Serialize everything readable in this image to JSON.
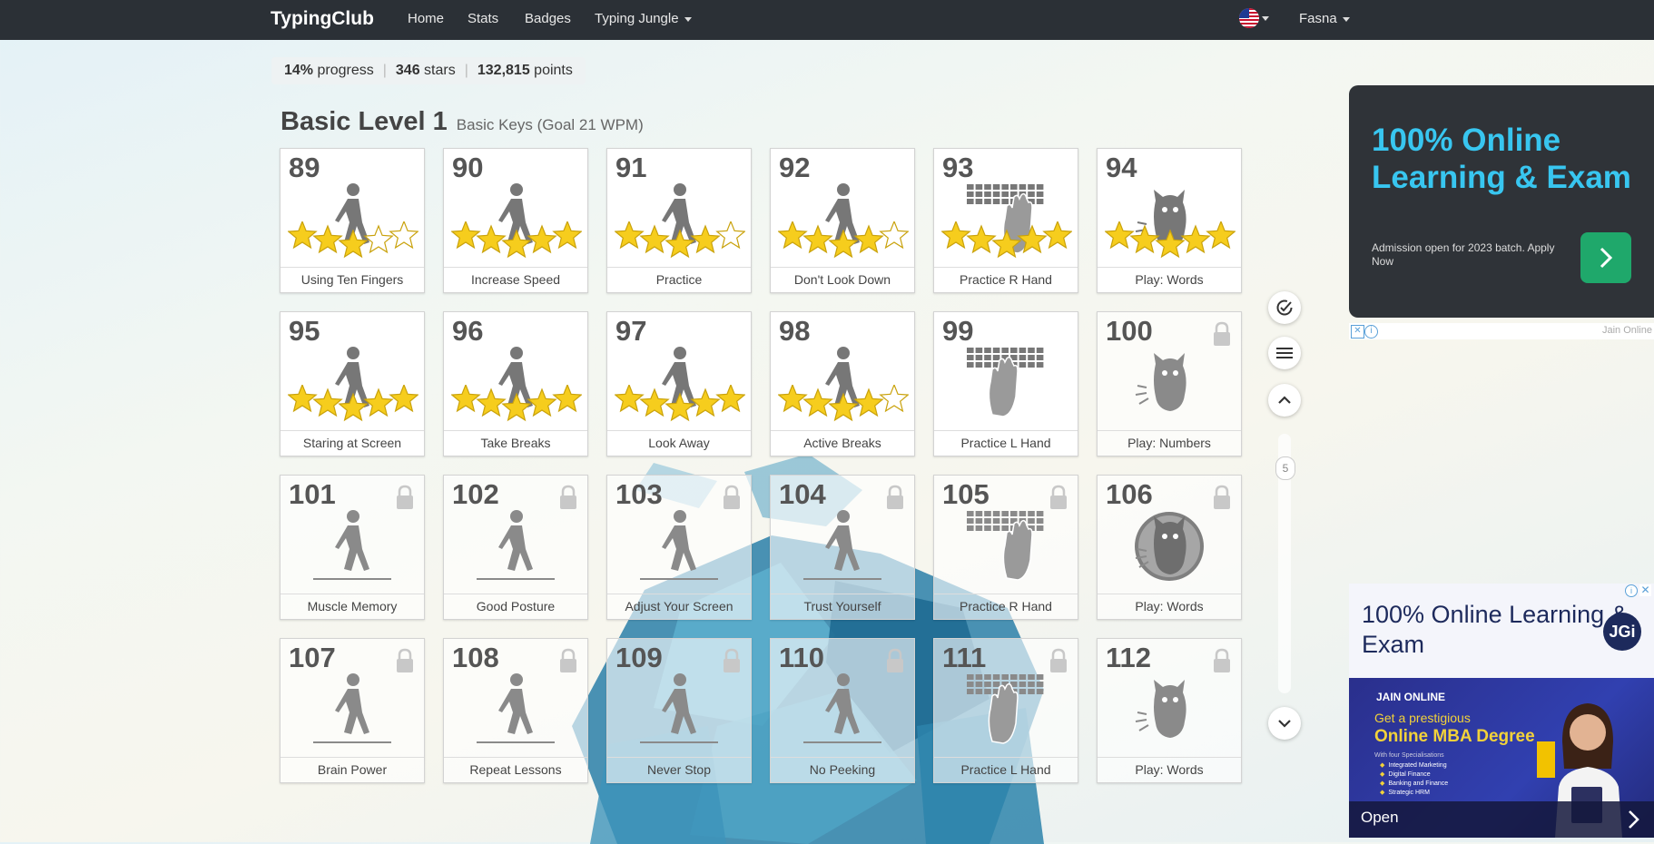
{
  "nav": {
    "brand": "TypingClub",
    "links": [
      "Home",
      "Stats",
      "Badges",
      "Typing Jungle"
    ],
    "user": "Fasna"
  },
  "progress": {
    "percent": "14%",
    "percent_label": "progress",
    "stars": "346",
    "stars_label": "stars",
    "points": "132,815",
    "points_label": "points"
  },
  "level": {
    "title": "Basic Level 1",
    "subtitle": "Basic Keys (Goal 21 WPM)"
  },
  "lessons": [
    {
      "num": "89",
      "label": "Using Ten Fingers",
      "icon": "walker",
      "stars": 3,
      "locked": false
    },
    {
      "num": "90",
      "label": "Increase Speed",
      "icon": "walker",
      "stars": 5,
      "locked": false
    },
    {
      "num": "91",
      "label": "Practice",
      "icon": "walker",
      "stars": 4,
      "locked": false
    },
    {
      "num": "92",
      "label": "Don't Look Down",
      "icon": "walker",
      "stars": 4,
      "locked": false
    },
    {
      "num": "93",
      "label": "Practice R Hand",
      "icon": "right-hand",
      "stars": 5,
      "locked": false
    },
    {
      "num": "94",
      "label": "Play: Words",
      "icon": "monster",
      "stars": 5,
      "locked": false
    },
    {
      "num": "95",
      "label": "Staring at Screen",
      "icon": "walker",
      "stars": 5,
      "locked": false
    },
    {
      "num": "96",
      "label": "Take Breaks",
      "icon": "walker",
      "stars": 5,
      "locked": false
    },
    {
      "num": "97",
      "label": "Look Away",
      "icon": "walker",
      "stars": 5,
      "locked": false
    },
    {
      "num": "98",
      "label": "Active Breaks",
      "icon": "walker",
      "stars": 4,
      "locked": false
    },
    {
      "num": "99",
      "label": "Practice L Hand",
      "icon": "left-hand",
      "stars": 0,
      "locked": false
    },
    {
      "num": "100",
      "label": "Play: Numbers",
      "icon": "monster",
      "stars": 0,
      "locked": true
    },
    {
      "num": "101",
      "label": "Muscle Memory",
      "icon": "walker-line",
      "stars": 0,
      "locked": true
    },
    {
      "num": "102",
      "label": "Good Posture",
      "icon": "walker-line",
      "stars": 0,
      "locked": true
    },
    {
      "num": "103",
      "label": "Adjust Your Screen",
      "icon": "walker-line",
      "stars": 0,
      "locked": true
    },
    {
      "num": "104",
      "label": "Trust Yourself",
      "icon": "walker-line",
      "stars": 0,
      "locked": true
    },
    {
      "num": "105",
      "label": "Practice R Hand",
      "icon": "right-hand",
      "stars": 0,
      "locked": true
    },
    {
      "num": "106",
      "label": "Play: Words",
      "icon": "monster-circle",
      "stars": 0,
      "locked": true
    },
    {
      "num": "107",
      "label": "Brain Power",
      "icon": "walker-line",
      "stars": 0,
      "locked": true
    },
    {
      "num": "108",
      "label": "Repeat Lessons",
      "icon": "walker-line",
      "stars": 0,
      "locked": true
    },
    {
      "num": "109",
      "label": "Never Stop",
      "icon": "walker-line",
      "stars": 0,
      "locked": true
    },
    {
      "num": "110",
      "label": "No Peeking",
      "icon": "walker-line",
      "stars": 0,
      "locked": true
    },
    {
      "num": "111",
      "label": "Practice L Hand",
      "icon": "left-hand",
      "stars": 0,
      "locked": true
    },
    {
      "num": "112",
      "label": "Play: Words",
      "icon": "monster",
      "stars": 0,
      "locked": true
    }
  ],
  "side": {
    "scroll_value": "5"
  },
  "ad_top": {
    "headline": "100% Online Learning & Exam",
    "text": "Admission open for 2023 batch. Apply Now",
    "source": "Jain Online"
  },
  "ad_bottom": {
    "headline": "100% Online Learning & Exam",
    "logo": "JGi",
    "brand": "JAIN ONLINE",
    "line1": "Get a prestigious",
    "line2": "Online MBA Degree",
    "line3": "With four Specialisations",
    "bullets": [
      "Integrated Marketing",
      "Digital Finance",
      "Banking and Finance",
      "Strategic HRM"
    ],
    "open": "Open"
  }
}
